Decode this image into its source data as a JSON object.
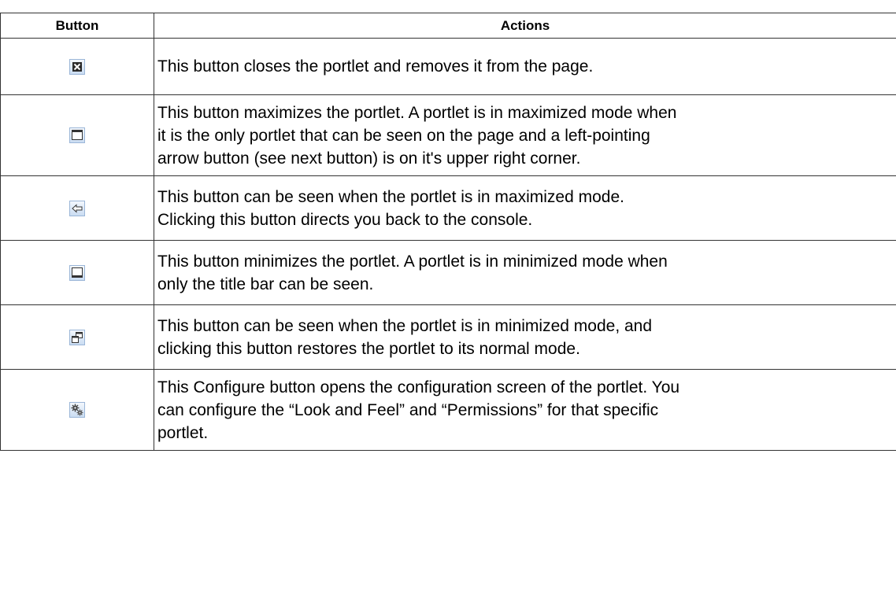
{
  "table": {
    "headers": {
      "button": "Button",
      "actions": "Actions"
    },
    "rows": [
      {
        "icon": "close-icon",
        "lines": [
          "This button closes the portlet and removes it from the page."
        ]
      },
      {
        "icon": "maximize-icon",
        "lines": [
          "This button maximizes the portlet. A portlet is in maximized mode when",
          "it is the only portlet that can be seen on the page and a left-pointing",
          "arrow button (see next button) is on it's upper right corner."
        ]
      },
      {
        "icon": "back-arrow-icon",
        "lines": [
          "This button can be seen when the portlet is in maximized mode.",
          "Clicking this button directs you back to the console."
        ]
      },
      {
        "icon": "minimize-icon",
        "lines": [
          "This button minimizes the portlet. A portlet is in minimized mode when",
          "only the title bar can be seen."
        ]
      },
      {
        "icon": "restore-icon",
        "lines": [
          "This button can be seen when the portlet is in minimized mode, and",
          "clicking this button restores the portlet to its normal mode."
        ]
      },
      {
        "icon": "configure-gears-icon",
        "lines": [
          "This Configure button opens the configuration screen of the portlet. You",
          "can configure the “Look and Feel” and “Permissions” for that specific",
          "portlet."
        ]
      }
    ]
  }
}
